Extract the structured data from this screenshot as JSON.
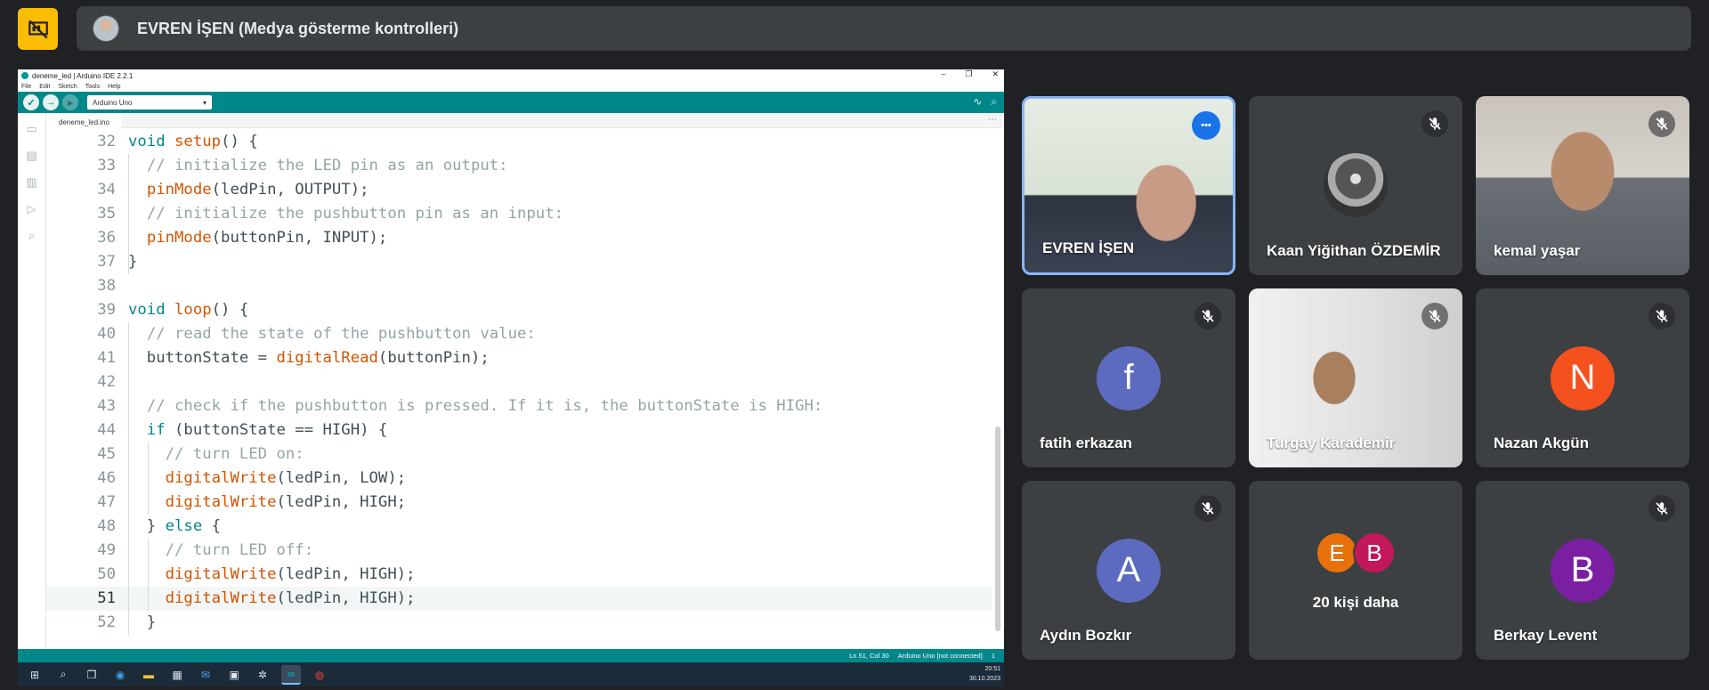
{
  "meet": {
    "presenter_banner": "EVREN İŞEN (Medya gösterme kontrolleri)",
    "present_icon": "presentation-off-icon"
  },
  "ide": {
    "title": "deneme_led | Arduino IDE 2.2.1",
    "menu": [
      "File",
      "Edit",
      "Sketch",
      "Tools",
      "Help"
    ],
    "board": "Arduino Uno",
    "tab": "deneme_led.ino",
    "status": [
      "Ln 51, Col 30",
      "Arduino Uno [not connected]",
      "1"
    ],
    "code": [
      {
        "n": "32",
        "t": "void setup() {"
      },
      {
        "n": "33",
        "t": "  // initialize the LED pin as an output:"
      },
      {
        "n": "34",
        "t": "  pinMode(ledPin, OUTPUT);"
      },
      {
        "n": "35",
        "t": "  // initialize the pushbutton pin as an input:"
      },
      {
        "n": "36",
        "t": "  pinMode(buttonPin, INPUT);"
      },
      {
        "n": "37",
        "t": "}"
      },
      {
        "n": "38",
        "t": ""
      },
      {
        "n": "39",
        "t": "void loop() {"
      },
      {
        "n": "40",
        "t": "  // read the state of the pushbutton value:"
      },
      {
        "n": "41",
        "t": "  buttonState = digitalRead(buttonPin);"
      },
      {
        "n": "42",
        "t": ""
      },
      {
        "n": "43",
        "t": "  // check if the pushbutton is pressed. If it is, the buttonState is HIGH:"
      },
      {
        "n": "44",
        "t": "  if (buttonState == HIGH) {"
      },
      {
        "n": "45",
        "t": "    // turn LED on:"
      },
      {
        "n": "46",
        "t": "    digitalWrite(ledPin, LOW);"
      },
      {
        "n": "47",
        "t": "    digitalWrite(ledPin, HIGH;"
      },
      {
        "n": "48",
        "t": "  } else {"
      },
      {
        "n": "49",
        "t": "    // turn LED off:"
      },
      {
        "n": "50",
        "t": "    digitalWrite(ledPin, HIGH);"
      },
      {
        "n": "51",
        "t": "    digitalWrite(ledPin, HIGH);",
        "active": true
      },
      {
        "n": "52",
        "t": "  }"
      }
    ],
    "taskbar": {
      "time": "20:51",
      "date": "30.10.2023",
      "items": [
        "windows-start-icon",
        "search-icon",
        "task-view-icon",
        "edge-icon",
        "file-explorer-icon",
        "store-icon",
        "mail-icon",
        "app-icon",
        "app-icon-2",
        "arduino-icon",
        "chrome-icon"
      ]
    }
  },
  "participants": [
    {
      "name": "EVREN İŞEN",
      "type": "video",
      "speaking": true
    },
    {
      "name": "Kaan Yiğithan ÖZDEMİR",
      "type": "image",
      "muted": true
    },
    {
      "name": "kemal yaşar",
      "type": "video",
      "muted": true
    },
    {
      "name": "fatih erkazan",
      "type": "letter",
      "letter": "f",
      "color": "#5c6bc0",
      "muted": true
    },
    {
      "name": "Turgay Karademir",
      "type": "video",
      "muted": true
    },
    {
      "name": "Nazan Akgün",
      "type": "letter",
      "letter": "N",
      "color": "#f4511e",
      "muted": true
    },
    {
      "name": "Aydın Bozkır",
      "type": "letter",
      "letter": "A",
      "color": "#5c6bc0",
      "muted": true
    },
    {
      "name": "20 kişi daha",
      "type": "others",
      "letters": [
        "E",
        "B"
      ],
      "colors": [
        "#e8710a",
        "#c2185b"
      ]
    },
    {
      "name": "Berkay Levent",
      "type": "letter",
      "letter": "B",
      "color": "#7b1fa2",
      "muted": true
    }
  ]
}
